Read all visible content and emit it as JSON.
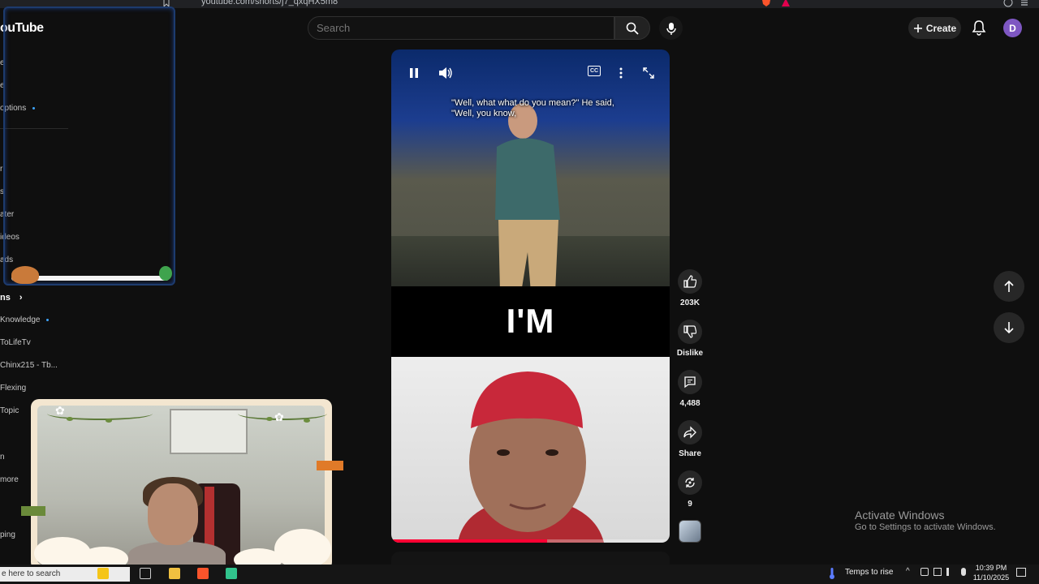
{
  "browser": {
    "url": "youtube.com/shorts/j7_qxqHX5m8"
  },
  "header": {
    "logo": "ouTube",
    "search_placeholder": "Search",
    "create_label": "Create",
    "avatar_letter": "D"
  },
  "sidebar": {
    "items": [
      {
        "label": "e"
      },
      {
        "label": "e"
      },
      {
        "label": "options"
      },
      {
        "label": "r"
      },
      {
        "label": "s"
      },
      {
        "label": "ater"
      },
      {
        "label": "ideos"
      },
      {
        "label": "ads"
      },
      {
        "label": "ns"
      },
      {
        "label": "Knowledge"
      },
      {
        "label": "ToLifeTv"
      },
      {
        "label": "Chinx215 - Tb..."
      },
      {
        "label": "Flexing"
      },
      {
        "label": "Topic"
      },
      {
        "label": "n"
      },
      {
        "label": "more"
      },
      {
        "label": "ping"
      }
    ]
  },
  "player": {
    "caption_line1": "\"Well, what what do you mean?\" He said,",
    "caption_line2": "\"Well, you know,",
    "big_text": "I'M",
    "progress": 0.56,
    "cc_label": "CC"
  },
  "actions": {
    "like_count": "203K",
    "dislike_label": "Dislike",
    "comment_count": "4,488",
    "share_label": "Share",
    "remix_count": "9"
  },
  "watermark": {
    "title": "Activate Windows",
    "subtitle": "Go to Settings to activate Windows."
  },
  "taskbar": {
    "search_text": "e here to search",
    "weather": "Temps to rise",
    "time": "10:39 PM",
    "date": "11/10/2025"
  },
  "colors": {
    "accent_red": "#ff0033",
    "avatar_purple": "#7e57c2",
    "link_blue": "#3ea6ff"
  }
}
